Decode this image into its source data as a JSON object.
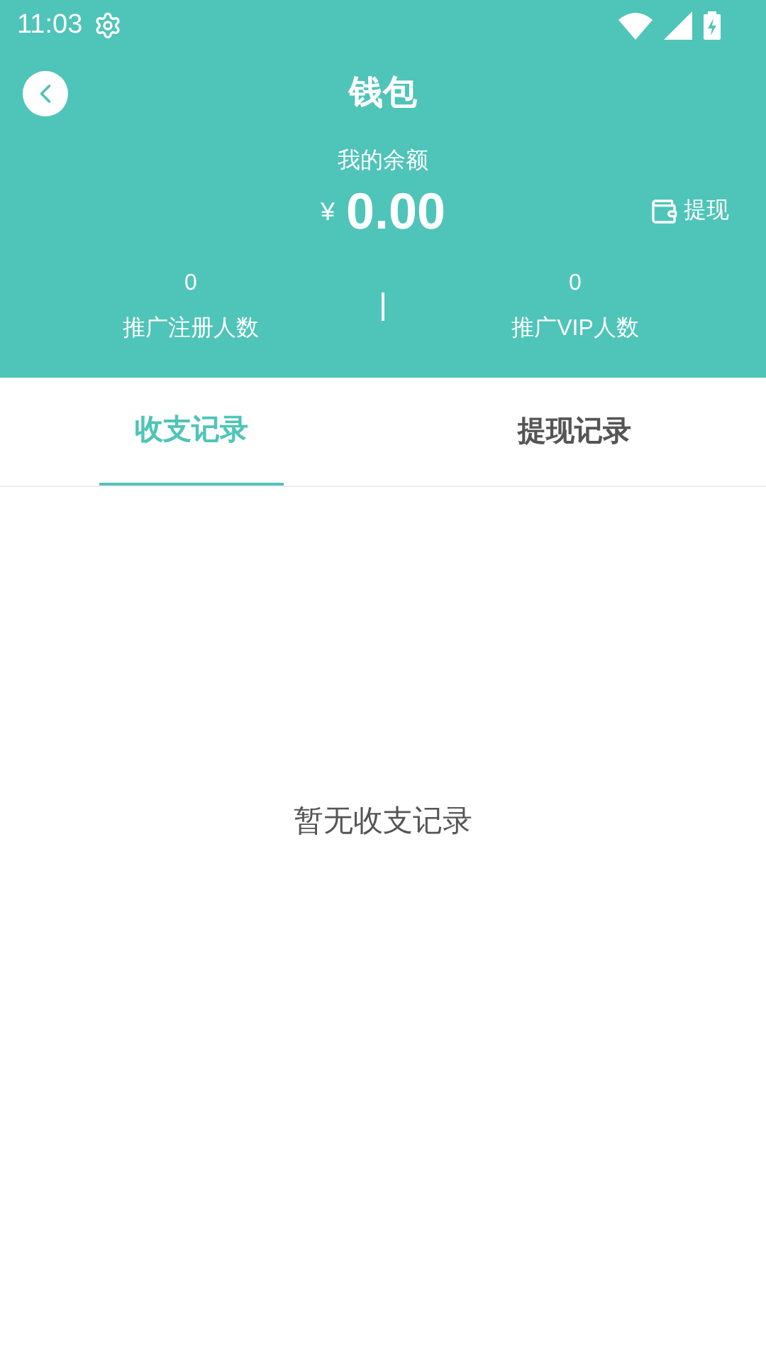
{
  "status_bar": {
    "time": "11:03"
  },
  "header": {
    "title": "钱包"
  },
  "balance": {
    "label": "我的余额",
    "currency": "¥",
    "amount": "0.00",
    "withdraw": "提现"
  },
  "stats": [
    {
      "value": "0",
      "label": "推广注册人数"
    },
    {
      "value": "0",
      "label": "推广VIP人数"
    }
  ],
  "tabs": [
    {
      "label": "收支记录",
      "selected": true
    },
    {
      "label": "提现记录",
      "selected": false
    }
  ],
  "empty_message": "暂无收支记录"
}
